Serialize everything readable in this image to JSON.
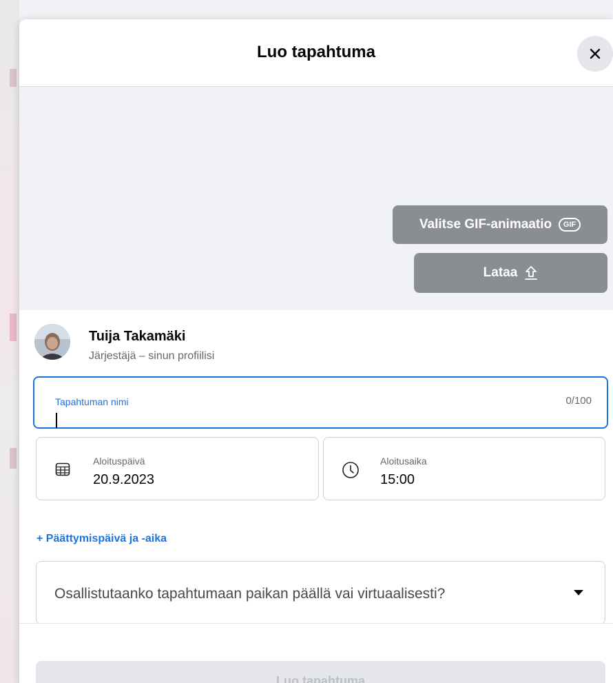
{
  "dialog": {
    "title": "Luo tapahtuma",
    "close_icon": "close-icon"
  },
  "cover": {
    "gif_button": {
      "label": "Valitse GIF-animaatio",
      "badge": "GIF"
    },
    "upload_button": {
      "label": "Lataa",
      "icon": "upload-icon"
    }
  },
  "organizer": {
    "name": "Tuija Takamäki",
    "role": "Järjestäjä – sinun profiilisi"
  },
  "event_name": {
    "label": "Tapahtuman nimi",
    "value": "",
    "counter": "0/100"
  },
  "start_date": {
    "label": "Aloituspäivä",
    "value": "20.9.2023",
    "icon": "calendar-icon"
  },
  "start_time": {
    "label": "Aloitusaika",
    "value": "15:00",
    "icon": "clock-icon"
  },
  "end_link": {
    "label": "+ Päättymispäivä ja -aika"
  },
  "venue": {
    "placeholder": "Osallistutaanko tapahtumaan paikan päällä vai virtuaalisesti?",
    "icon": "caret-down-icon"
  },
  "footer": {
    "submit_label": "Luo tapahtuma"
  },
  "colors": {
    "accent": "#1b74e4",
    "button_gray": "#8a8d91",
    "disabled_bg": "#e4e6eb",
    "disabled_text": "#bcc0c4"
  }
}
